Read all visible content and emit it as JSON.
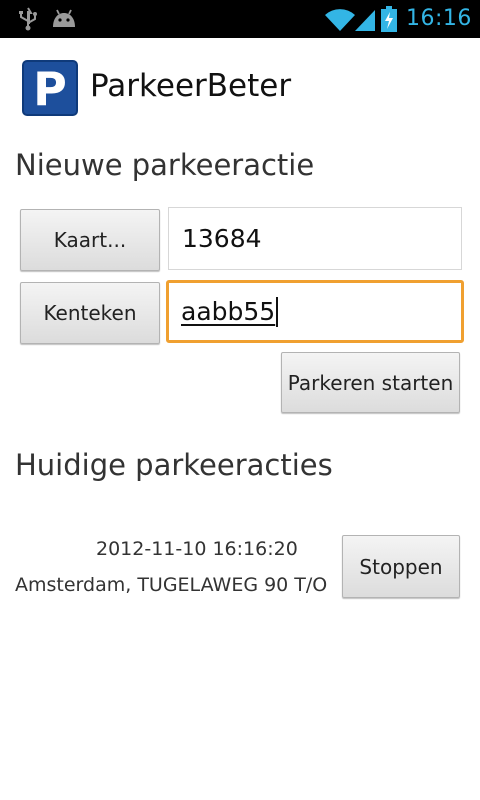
{
  "status_bar": {
    "time": "16:16",
    "icons": [
      "usb-icon",
      "android-icon",
      "wifi-icon",
      "signal-icon",
      "battery-charging-icon"
    ],
    "accent_color": "#33b5e5"
  },
  "app": {
    "logo_letter": "P",
    "title": "ParkeerBeter",
    "brand_color": "#1d4f9c"
  },
  "new_session": {
    "heading": "Nieuwe parkeeractie",
    "card_button_label": "Kaart...",
    "card_number_value": "13684",
    "plate_button_label": "Kenteken",
    "plate_value": "aabb55",
    "start_button_label": "Parkeren starten",
    "focus_color": "#f0a030"
  },
  "current_sessions": {
    "heading": "Huidige parkeeracties",
    "items": [
      {
        "start_time": "2012-11-10 16:16:20",
        "location": "Amsterdam, TUGELAWEG 90 T/O",
        "stop_label": "Stoppen"
      }
    ]
  }
}
